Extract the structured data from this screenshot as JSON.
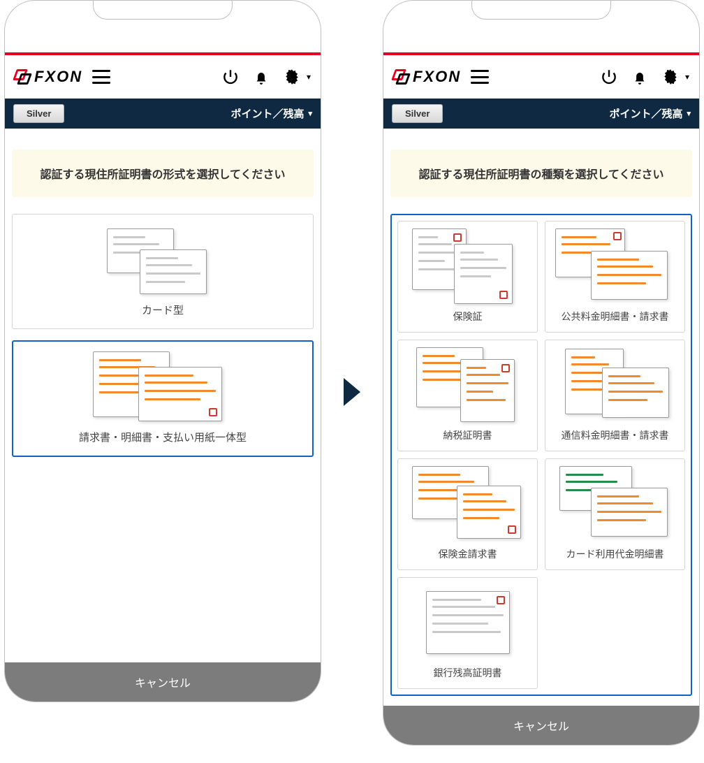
{
  "brand_text": "FXON",
  "tier_label": "Silver",
  "balance_toggle_label": "ポイント／残高",
  "cancel_label": "キャンセル",
  "left": {
    "prompt": "認証する現住所証明書の形式を選択してください",
    "options": [
      {
        "label": "カード型",
        "selected": false
      },
      {
        "label": "請求書・明細書・支払い用紙一体型",
        "selected": true
      }
    ]
  },
  "right": {
    "prompt": "認証する現住所証明書の種類を選択してください",
    "doc_types": [
      {
        "label": "保険証"
      },
      {
        "label": "公共料金明細書・請求書"
      },
      {
        "label": "納税証明書"
      },
      {
        "label": "通信料金明細書・請求書"
      },
      {
        "label": "保険金請求書"
      },
      {
        "label": "カード利用代金明細書"
      },
      {
        "label": "銀行残高証明書"
      }
    ]
  }
}
